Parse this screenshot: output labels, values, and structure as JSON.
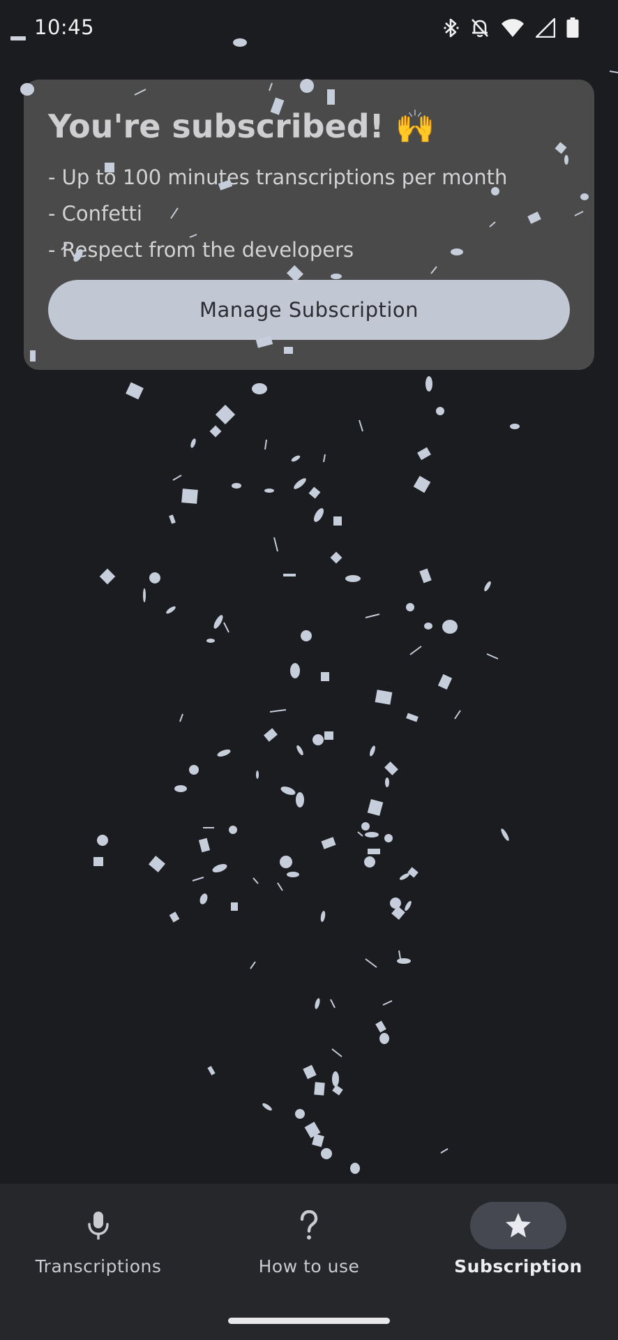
{
  "status_bar": {
    "time": "10:45"
  },
  "card": {
    "title": "You're subscribed! 🙌",
    "benefits": [
      "- Up to 100 minutes transcriptions per month",
      "- Confetti",
      "- Respect from the developers"
    ],
    "manage_label": "Manage Subscription"
  },
  "bottom_nav": {
    "items": [
      {
        "label": "Transcriptions",
        "icon": "microphone-icon",
        "selected": false
      },
      {
        "label": "How to use",
        "icon": "question-mark-icon",
        "selected": false
      },
      {
        "label": "Subscription",
        "icon": "star-icon",
        "selected": true
      }
    ]
  },
  "colors": {
    "background": "#1b1c1f",
    "card": "#4a4a4a",
    "button": "#c2c7d4",
    "confetti": "#c7cedb",
    "nav_background": "#26272b",
    "nav_selected_pill": "#454851"
  }
}
